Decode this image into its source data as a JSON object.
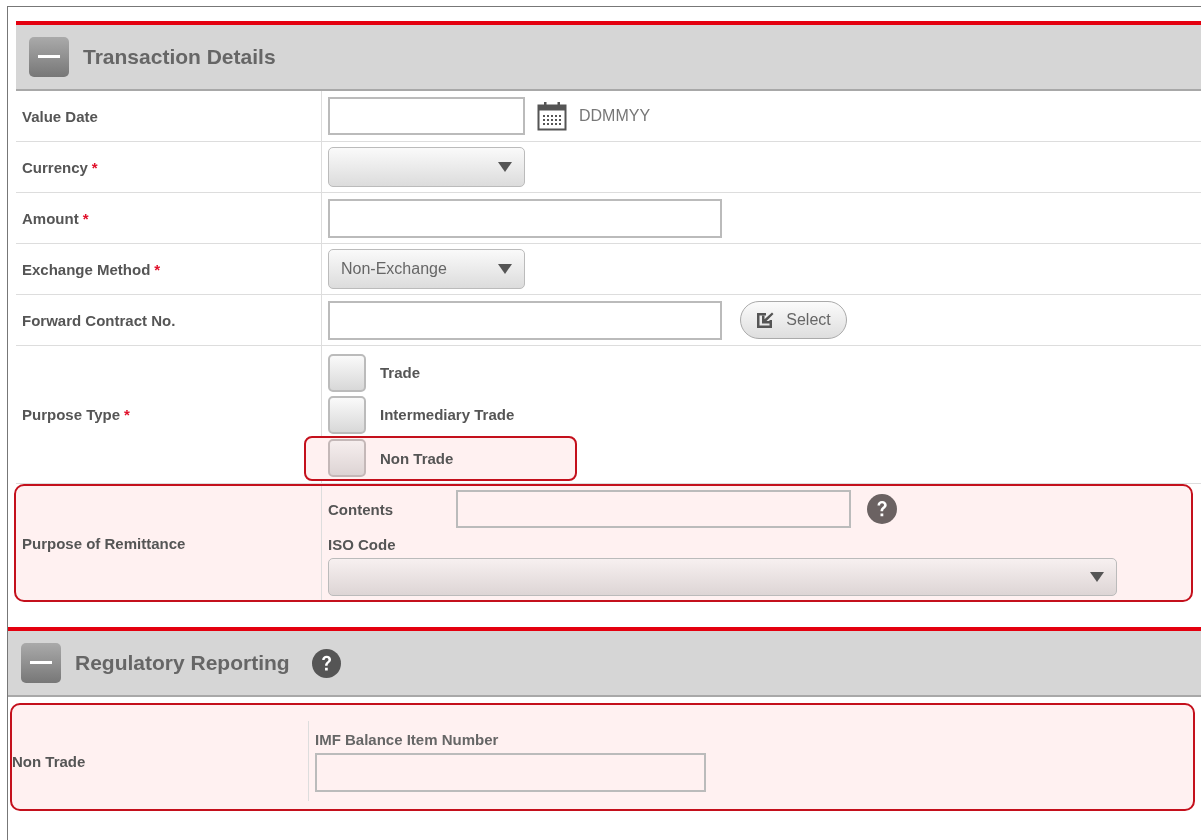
{
  "sections": [
    {
      "title": "Transaction Details",
      "expanded": true,
      "help": false,
      "rows": [
        {
          "kind": "date",
          "label": "Value Date",
          "format_hint": "DDMMYY"
        },
        {
          "kind": "select",
          "label": "Currency",
          "required_mark": "*"
        },
        {
          "kind": "text",
          "label": "Amount",
          "required_mark": "*"
        },
        {
          "kind": "select",
          "label": "Exchange Method",
          "required_mark": "*",
          "value": "Non-Exchange"
        },
        {
          "kind": "lookup",
          "label": "Forward Contract No.",
          "button": "Select"
        },
        {
          "kind": "checkboxes",
          "label": "Purpose Type",
          "required_mark": "*",
          "options": [
            {
              "label": "Trade",
              "checked": false,
              "highlighted": false
            },
            {
              "label": "Intermediary Trade",
              "checked": false,
              "highlighted": false
            },
            {
              "label": "Non Trade",
              "checked": false,
              "highlighted": true
            }
          ]
        },
        {
          "kind": "remittance",
          "label": "Purpose of Remittance",
          "highlighted": true,
          "contents_label": "Contents",
          "iso_label": "ISO Code"
        }
      ]
    },
    {
      "title": "Regulatory Reporting",
      "expanded": true,
      "help": true,
      "rows": [
        {
          "kind": "field_below",
          "label": "Non Trade",
          "highlighted": true,
          "field_label": "IMF Balance Item Number"
        }
      ]
    }
  ]
}
